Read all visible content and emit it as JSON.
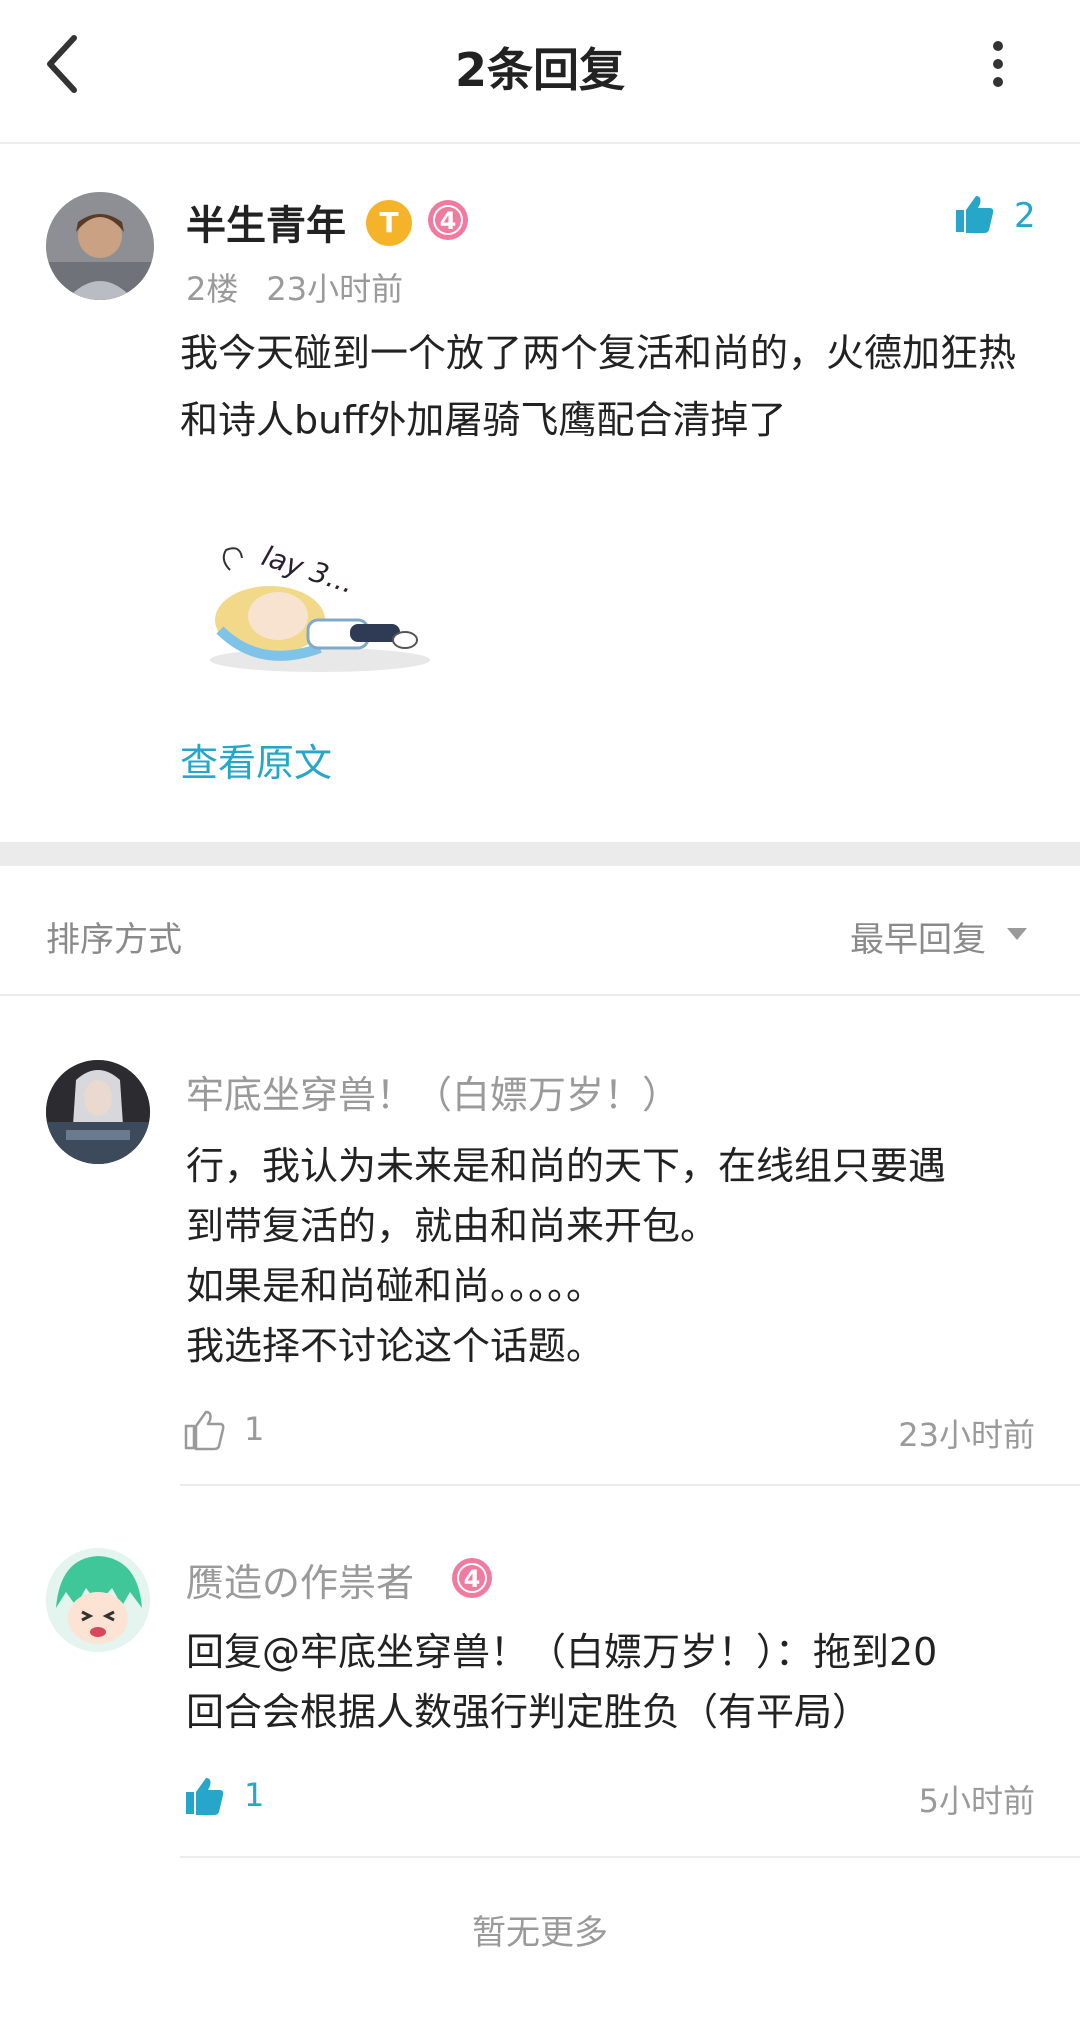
{
  "header": {
    "title": "2条回复",
    "back_icon": "chevron-left-icon",
    "more_icon": "more-vertical-icon"
  },
  "original_post": {
    "author": "半生青年",
    "badge_title": "T",
    "level_badge": "4",
    "floor": "2楼",
    "time": "23小时前",
    "like_count": "2",
    "content": "我今天碰到一个放了两个复活和尚的，火德加狂热和诗人buff外加屠骑飞鹰配合清掉了",
    "sticker_text": "lay 3...",
    "view_original": "查看原文"
  },
  "sort": {
    "label": "排序方式",
    "value": "最早回复"
  },
  "replies": [
    {
      "author": "牢底坐穿兽！（白嫖万岁！）",
      "content_lines": [
        "行，我认为未来是和尚的天下，在线组只要遇",
        "到带复活的，就由和尚来开包。",
        "如果是和尚碰和尚。。。。。",
        "我选择不讨论这个话题。"
      ],
      "like_count": "1",
      "time": "23小时前",
      "liked": false
    },
    {
      "author": "赝造の作祟者",
      "level_badge": "4",
      "content_lines": [
        "回复@牢底坐穿兽！（白嫖万岁！）：拖到20",
        "回合会根据人数强行判定胜负（有平局）"
      ],
      "like_count": "1",
      "time": "5小时前",
      "liked": true
    }
  ],
  "footer": {
    "end_text": "暂无更多"
  },
  "colors": {
    "accent": "#26a6c8",
    "level_badge": "#f07aa0",
    "title_badge": "#f5b329",
    "muted": "#9a9a9a"
  }
}
